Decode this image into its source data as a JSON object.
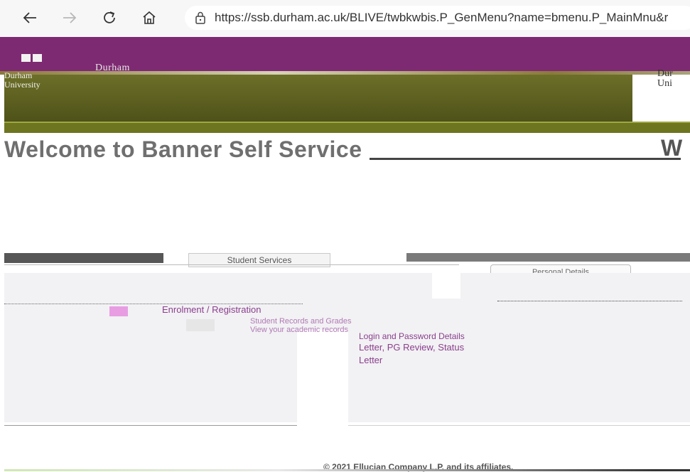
{
  "browser": {
    "back_icon": "arrow-left-icon",
    "forward_icon": "arrow-right-icon",
    "reload_icon": "reload-icon",
    "home_icon": "home-icon",
    "lock_icon": "lock-icon",
    "url": "https://ssb.durham.ac.uk/BLIVE/twbkwbis.P_GenMenu?name=bmenu.P_MainMnu&r"
  },
  "header": {
    "logo_left_line1": "Durham",
    "logo_left_line2": "University",
    "logo_mid": "Durham",
    "logo_right_line1": "Dur",
    "logo_right_line2": "Uni"
  },
  "welcome": {
    "title": "Welcome to Banner Self Service",
    "right_fragment": "W"
  },
  "tabs": {
    "active": "Student Services",
    "secondary": "Personal Details"
  },
  "content": {
    "link_registration": "Enrolment / Registration",
    "link_records": "Student Records and Grades",
    "link_records_sub": "View your academic records",
    "link_access": "Login and Password Details",
    "link_status": "Letter, PG Review, Status",
    "link_letter": "Letter"
  },
  "footer": {
    "copyright": "© 2021 Ellucian Company L.P. and its affiliates."
  },
  "colors": {
    "purple": "#7e2a72",
    "olive": "#5f6222",
    "link": "#8a3f8c"
  }
}
